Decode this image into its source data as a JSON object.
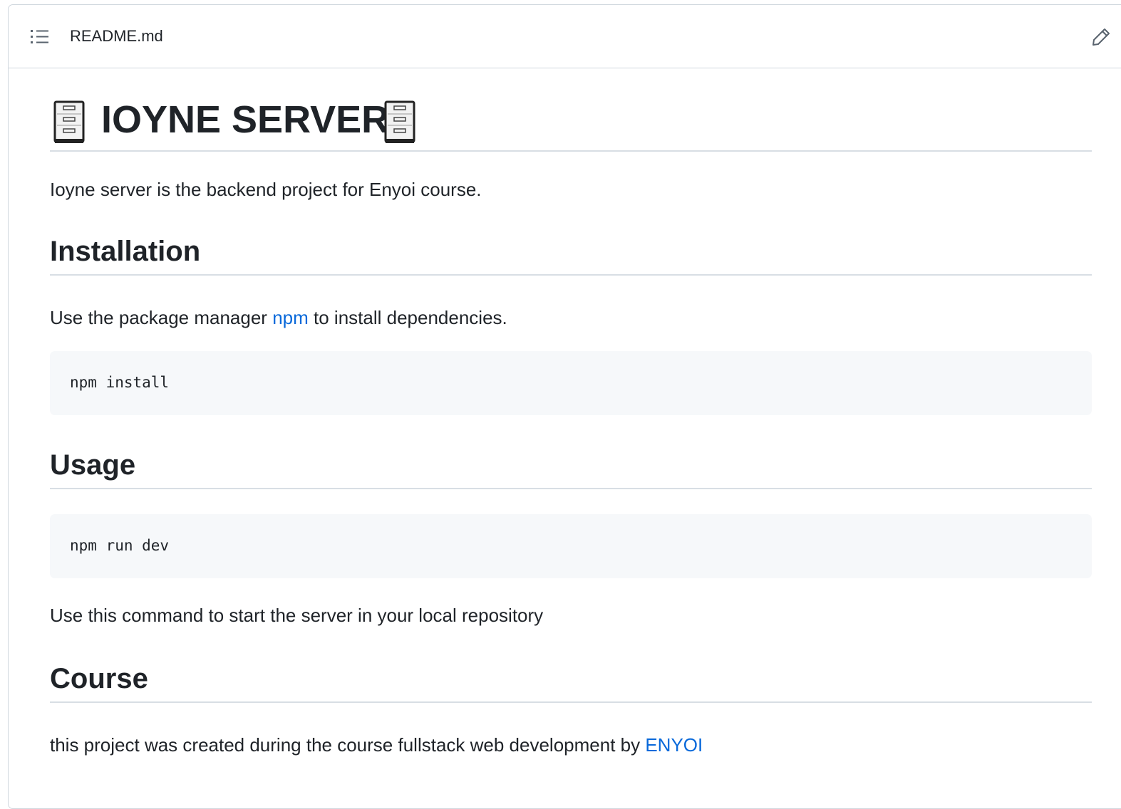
{
  "header": {
    "filename": "README.md",
    "toc_icon": "list-unordered-icon",
    "edit_icon": "pencil-icon"
  },
  "content": {
    "title": "IOYNE SERVER",
    "title_icon": "file-cabinet-icon",
    "intro": "Ioyne server is the backend project for Enyoi course.",
    "installation": {
      "heading": "Installation",
      "text_before": "Use the package manager ",
      "link": "npm",
      "text_after": " to install dependencies.",
      "code": "npm install"
    },
    "usage": {
      "heading": "Usage",
      "code": "npm run dev",
      "text": "Use this command to start the server in your local repository"
    },
    "course": {
      "heading": "Course",
      "text_before": "this project was created during the course fullstack web development by ",
      "link": "ENYOI"
    }
  },
  "colors": {
    "text": "#1f2328",
    "link": "#0969da",
    "border": "#d0d7de",
    "code_bg": "#f6f8fa"
  }
}
